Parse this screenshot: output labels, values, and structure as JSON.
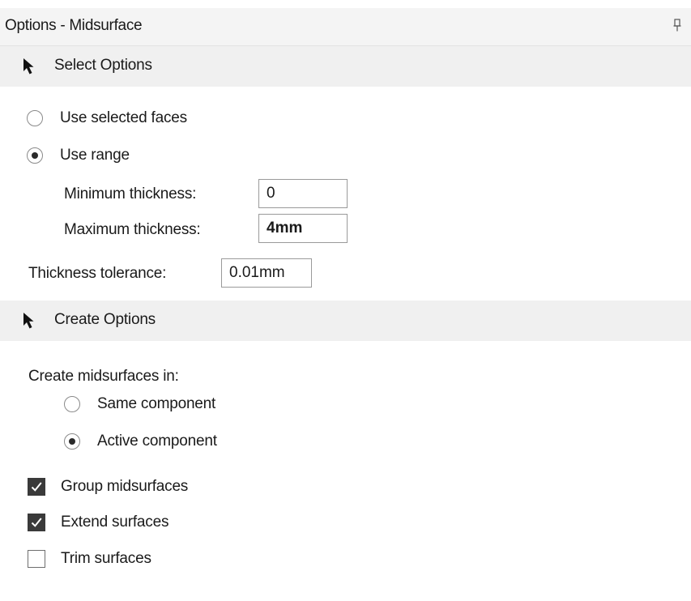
{
  "panel": {
    "title": "Options - Midsurface",
    "pin_icon": "pin-icon"
  },
  "select_options": {
    "header": "Select Options",
    "icon": "cursor-arrow-icon",
    "radio_selected_faces": "Use selected faces",
    "radio_use_range": "Use range",
    "selected_mode": "Use range",
    "min_thickness_label": "Minimum thickness:",
    "min_thickness_value": "0",
    "max_thickness_label": "Maximum thickness:",
    "max_thickness_value": "4mm",
    "tolerance_label": "Thickness tolerance:",
    "tolerance_value": "0.01mm"
  },
  "create_options": {
    "header": "Create Options",
    "icon": "cursor-arrow-icon",
    "create_in_label": "Create midsurfaces in:",
    "radio_same_component": "Same component",
    "radio_active_component": "Active component",
    "selected_target": "Active component",
    "group_midsurfaces": {
      "label": "Group midsurfaces",
      "checked": true
    },
    "extend_surfaces": {
      "label": "Extend surfaces",
      "checked": true
    },
    "trim_surfaces": {
      "label": "Trim surfaces",
      "checked": false
    }
  },
  "colors": {
    "header_bg": "#f0f0f0",
    "titlebar_bg": "#f4f4f4",
    "check_fill": "#3a3a3a",
    "border": "#9a9a9a"
  }
}
